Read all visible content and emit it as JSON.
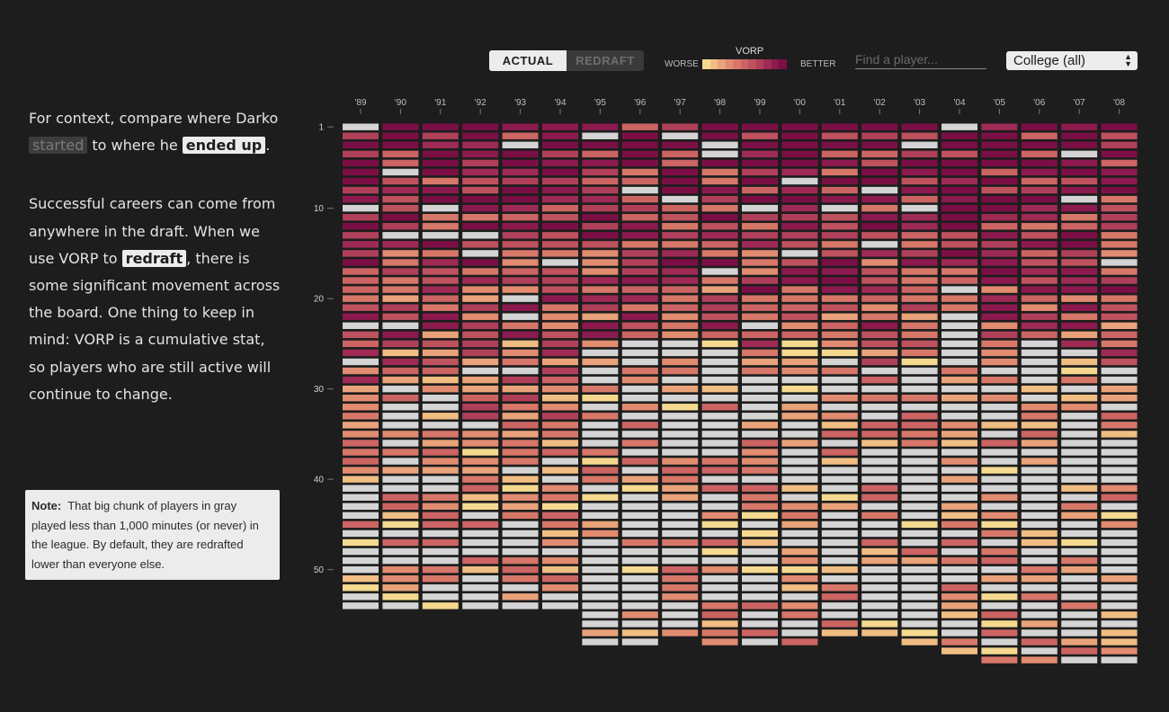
{
  "toggle": {
    "actual_label": "ACTUAL",
    "redraft_label": "REDRAFT",
    "selected": "ACTUAL"
  },
  "legend": {
    "title": "VORP",
    "worse_label": "WORSE",
    "better_label": "BETTER",
    "colors": [
      "#f5d98f",
      "#f0bd83",
      "#e9a279",
      "#e18b70",
      "#d77769",
      "#cb6463",
      "#bf525f",
      "#b0405a",
      "#9e2a55",
      "#8c1a4e",
      "#7b0f45"
    ]
  },
  "search": {
    "placeholder": "Find a player..."
  },
  "college_select": {
    "value": "College (all)"
  },
  "narrative": {
    "p1_a": "For context, compare where Darko ",
    "p1_started": "started",
    "p1_b": " to where he ",
    "p1_ended": "ended up",
    "p1_c": ".",
    "p2_a": "Successful careers can come from anywhere in the draft. When we use VORP to ",
    "p2_redraft": "redraft",
    "p2_b": ", there is some significant movement across the board. One thing to keep in mind: VORP is a cumulative stat, so players who are still active will continue to change."
  },
  "note": {
    "label": "Note:",
    "text": "That big chunk of players in gray played less than 1,000 minutes (or never) in the league. By default, they are redrafted lower than everyone else."
  },
  "colors": {
    "background": "#1d1d1d",
    "gray_cell": "#d4d4d4"
  },
  "chart_data": {
    "type": "heatmap",
    "x": [
      "'89",
      "'90",
      "'91",
      "'92",
      "'93",
      "'94",
      "'95",
      "'96",
      "'97",
      "'98",
      "'99",
      "'00",
      "'01",
      "'02",
      "'03",
      "'04",
      "'05",
      "'06",
      "'07",
      "'08"
    ],
    "y_ticks": [
      1,
      10,
      20,
      30,
      40,
      50
    ],
    "picks_per_year": [
      54,
      54,
      54,
      54,
      54,
      54,
      58,
      58,
      57,
      58,
      58,
      58,
      57,
      57,
      58,
      59,
      60,
      60,
      60,
      60
    ],
    "gray_meaning": "less than 1,000 minutes (or never)",
    "gray_from_pick_approx": [
      40,
      28,
      34,
      36,
      34,
      38,
      26,
      24,
      22,
      24,
      26,
      25,
      24,
      28,
      26,
      22,
      26,
      24,
      26,
      28
    ],
    "color_scale": {
      "metric": "VORP",
      "low": "WORSE",
      "high": "BETTER"
    }
  }
}
